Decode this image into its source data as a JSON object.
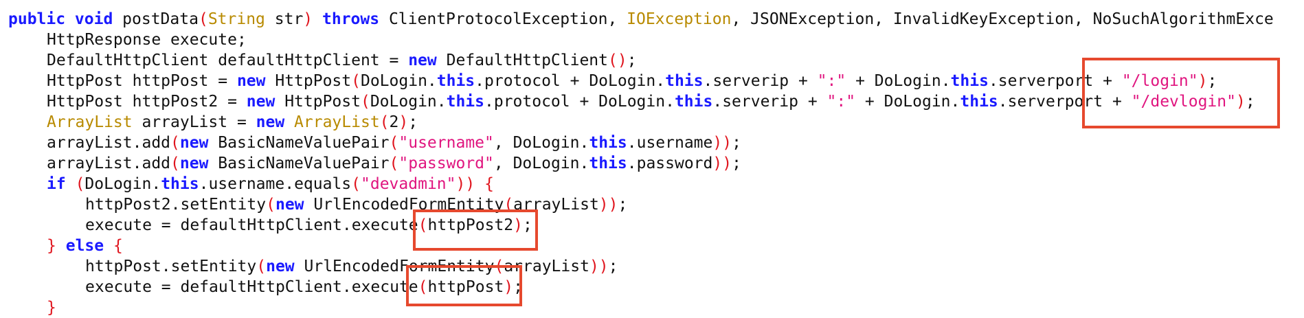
{
  "code": {
    "lines": [
      {
        "indent": 0,
        "tokens": [
          {
            "t": "public void ",
            "k": "kw"
          },
          {
            "t": "postData",
            "k": "tx"
          },
          {
            "t": "(",
            "k": "pn"
          },
          {
            "t": "String",
            "k": "ty"
          },
          {
            "t": " str",
            "k": "tx"
          },
          {
            "t": ")",
            "k": "pn"
          },
          {
            "t": " ",
            "k": "tx"
          },
          {
            "t": "throws",
            "k": "kw"
          },
          {
            "t": " ClientProtocolException, ",
            "k": "tx"
          },
          {
            "t": "IOException",
            "k": "ty"
          },
          {
            "t": ", JSONException, InvalidKeyException, NoSuchAlgorithmExce",
            "k": "tx"
          }
        ]
      },
      {
        "indent": 1,
        "tokens": [
          {
            "t": "HttpResponse execute;",
            "k": "tx"
          }
        ]
      },
      {
        "indent": 1,
        "tokens": [
          {
            "t": "DefaultHttpClient defaultHttpClient = ",
            "k": "tx"
          },
          {
            "t": "new",
            "k": "kw"
          },
          {
            "t": " DefaultHttpClient",
            "k": "tx"
          },
          {
            "t": "()",
            "k": "pn"
          },
          {
            "t": ";",
            "k": "tx"
          }
        ]
      },
      {
        "indent": 1,
        "tokens": [
          {
            "t": "HttpPost httpPost = ",
            "k": "tx"
          },
          {
            "t": "new",
            "k": "kw"
          },
          {
            "t": " HttpPost",
            "k": "tx"
          },
          {
            "t": "(",
            "k": "pn"
          },
          {
            "t": "DoLogin.",
            "k": "tx"
          },
          {
            "t": "this",
            "k": "kw"
          },
          {
            "t": ".protocol + DoLogin.",
            "k": "tx"
          },
          {
            "t": "this",
            "k": "kw"
          },
          {
            "t": ".serverip + ",
            "k": "tx"
          },
          {
            "t": "\":\"",
            "k": "st"
          },
          {
            "t": " + DoLogin.",
            "k": "tx"
          },
          {
            "t": "this",
            "k": "kw"
          },
          {
            "t": ".serverport + ",
            "k": "tx"
          },
          {
            "t": "\"/login\"",
            "k": "st"
          },
          {
            "t": ")",
            "k": "pn"
          },
          {
            "t": ";",
            "k": "tx"
          }
        ]
      },
      {
        "indent": 1,
        "tokens": [
          {
            "t": "HttpPost httpPost2 = ",
            "k": "tx"
          },
          {
            "t": "new",
            "k": "kw"
          },
          {
            "t": " HttpPost",
            "k": "tx"
          },
          {
            "t": "(",
            "k": "pn"
          },
          {
            "t": "DoLogin.",
            "k": "tx"
          },
          {
            "t": "this",
            "k": "kw"
          },
          {
            "t": ".protocol + DoLogin.",
            "k": "tx"
          },
          {
            "t": "this",
            "k": "kw"
          },
          {
            "t": ".serverip + ",
            "k": "tx"
          },
          {
            "t": "\":\"",
            "k": "st"
          },
          {
            "t": " + DoLogin.",
            "k": "tx"
          },
          {
            "t": "this",
            "k": "kw"
          },
          {
            "t": ".serverport + ",
            "k": "tx"
          },
          {
            "t": "\"/devlogin\"",
            "k": "st"
          },
          {
            "t": ")",
            "k": "pn"
          },
          {
            "t": ";",
            "k": "tx"
          }
        ]
      },
      {
        "indent": 1,
        "tokens": [
          {
            "t": "ArrayList",
            "k": "ty"
          },
          {
            "t": " arrayList = ",
            "k": "tx"
          },
          {
            "t": "new",
            "k": "kw"
          },
          {
            "t": " ",
            "k": "tx"
          },
          {
            "t": "ArrayList",
            "k": "ty"
          },
          {
            "t": "(",
            "k": "pn"
          },
          {
            "t": "2",
            "k": "tx"
          },
          {
            "t": ")",
            "k": "pn"
          },
          {
            "t": ";",
            "k": "tx"
          }
        ]
      },
      {
        "indent": 1,
        "tokens": [
          {
            "t": "arrayList.add",
            "k": "tx"
          },
          {
            "t": "(",
            "k": "pn"
          },
          {
            "t": "new",
            "k": "kw"
          },
          {
            "t": " BasicNameValuePair",
            "k": "tx"
          },
          {
            "t": "(",
            "k": "pn"
          },
          {
            "t": "\"username\"",
            "k": "st"
          },
          {
            "t": ", DoLogin.",
            "k": "tx"
          },
          {
            "t": "this",
            "k": "kw"
          },
          {
            "t": ".username",
            "k": "tx"
          },
          {
            "t": "))",
            "k": "pn"
          },
          {
            "t": ";",
            "k": "tx"
          }
        ]
      },
      {
        "indent": 1,
        "tokens": [
          {
            "t": "arrayList.add",
            "k": "tx"
          },
          {
            "t": "(",
            "k": "pn"
          },
          {
            "t": "new",
            "k": "kw"
          },
          {
            "t": " BasicNameValuePair",
            "k": "tx"
          },
          {
            "t": "(",
            "k": "pn"
          },
          {
            "t": "\"password\"",
            "k": "st"
          },
          {
            "t": ", DoLogin.",
            "k": "tx"
          },
          {
            "t": "this",
            "k": "kw"
          },
          {
            "t": ".password",
            "k": "tx"
          },
          {
            "t": "))",
            "k": "pn"
          },
          {
            "t": ";",
            "k": "tx"
          }
        ]
      },
      {
        "indent": 1,
        "tokens": [
          {
            "t": "if",
            "k": "kw"
          },
          {
            "t": " ",
            "k": "tx"
          },
          {
            "t": "(",
            "k": "pn"
          },
          {
            "t": "DoLogin.",
            "k": "tx"
          },
          {
            "t": "this",
            "k": "kw"
          },
          {
            "t": ".username.equals",
            "k": "tx"
          },
          {
            "t": "(",
            "k": "pn"
          },
          {
            "t": "\"devadmin\"",
            "k": "st"
          },
          {
            "t": "))",
            "k": "pn"
          },
          {
            "t": " ",
            "k": "tx"
          },
          {
            "t": "{",
            "k": "pn"
          }
        ]
      },
      {
        "indent": 2,
        "tokens": [
          {
            "t": "httpPost2.setEntity",
            "k": "tx"
          },
          {
            "t": "(",
            "k": "pn"
          },
          {
            "t": "new",
            "k": "kw"
          },
          {
            "t": " UrlEncodedFormEntity",
            "k": "tx"
          },
          {
            "t": "(",
            "k": "pn"
          },
          {
            "t": "arrayList",
            "k": "tx"
          },
          {
            "t": "))",
            "k": "pn"
          },
          {
            "t": ";",
            "k": "tx"
          }
        ]
      },
      {
        "indent": 2,
        "tokens": [
          {
            "t": "execute = defaultHttpClient.execute",
            "k": "tx"
          },
          {
            "t": "(",
            "k": "pn"
          },
          {
            "t": "httpPost2",
            "k": "tx"
          },
          {
            "t": ")",
            "k": "pn"
          },
          {
            "t": ";",
            "k": "tx"
          }
        ]
      },
      {
        "indent": 1,
        "tokens": [
          {
            "t": "}",
            "k": "pn"
          },
          {
            "t": " ",
            "k": "tx"
          },
          {
            "t": "else",
            "k": "kw"
          },
          {
            "t": " ",
            "k": "tx"
          },
          {
            "t": "{",
            "k": "pn"
          }
        ]
      },
      {
        "indent": 2,
        "tokens": [
          {
            "t": "httpPost.setEntity",
            "k": "tx"
          },
          {
            "t": "(",
            "k": "pn"
          },
          {
            "t": "new",
            "k": "kw"
          },
          {
            "t": " UrlEncodedFormEntity",
            "k": "tx"
          },
          {
            "t": "(",
            "k": "pn"
          },
          {
            "t": "arrayList",
            "k": "tx"
          },
          {
            "t": "))",
            "k": "pn"
          },
          {
            "t": ";",
            "k": "tx"
          }
        ]
      },
      {
        "indent": 2,
        "tokens": [
          {
            "t": "execute = defaultHttpClient.execute",
            "k": "tx"
          },
          {
            "t": "(",
            "k": "pn"
          },
          {
            "t": "httpPost",
            "k": "tx"
          },
          {
            "t": ")",
            "k": "pn"
          },
          {
            "t": ";",
            "k": "tx"
          }
        ]
      },
      {
        "indent": 1,
        "tokens": [
          {
            "t": "}",
            "k": "pn"
          }
        ]
      }
    ]
  },
  "colors": {
    "keyword": "#1a1aff",
    "punctuation": "#e0151e",
    "string": "#e0157f",
    "type": "#b88a00",
    "highlight_box": "#e6492e"
  }
}
